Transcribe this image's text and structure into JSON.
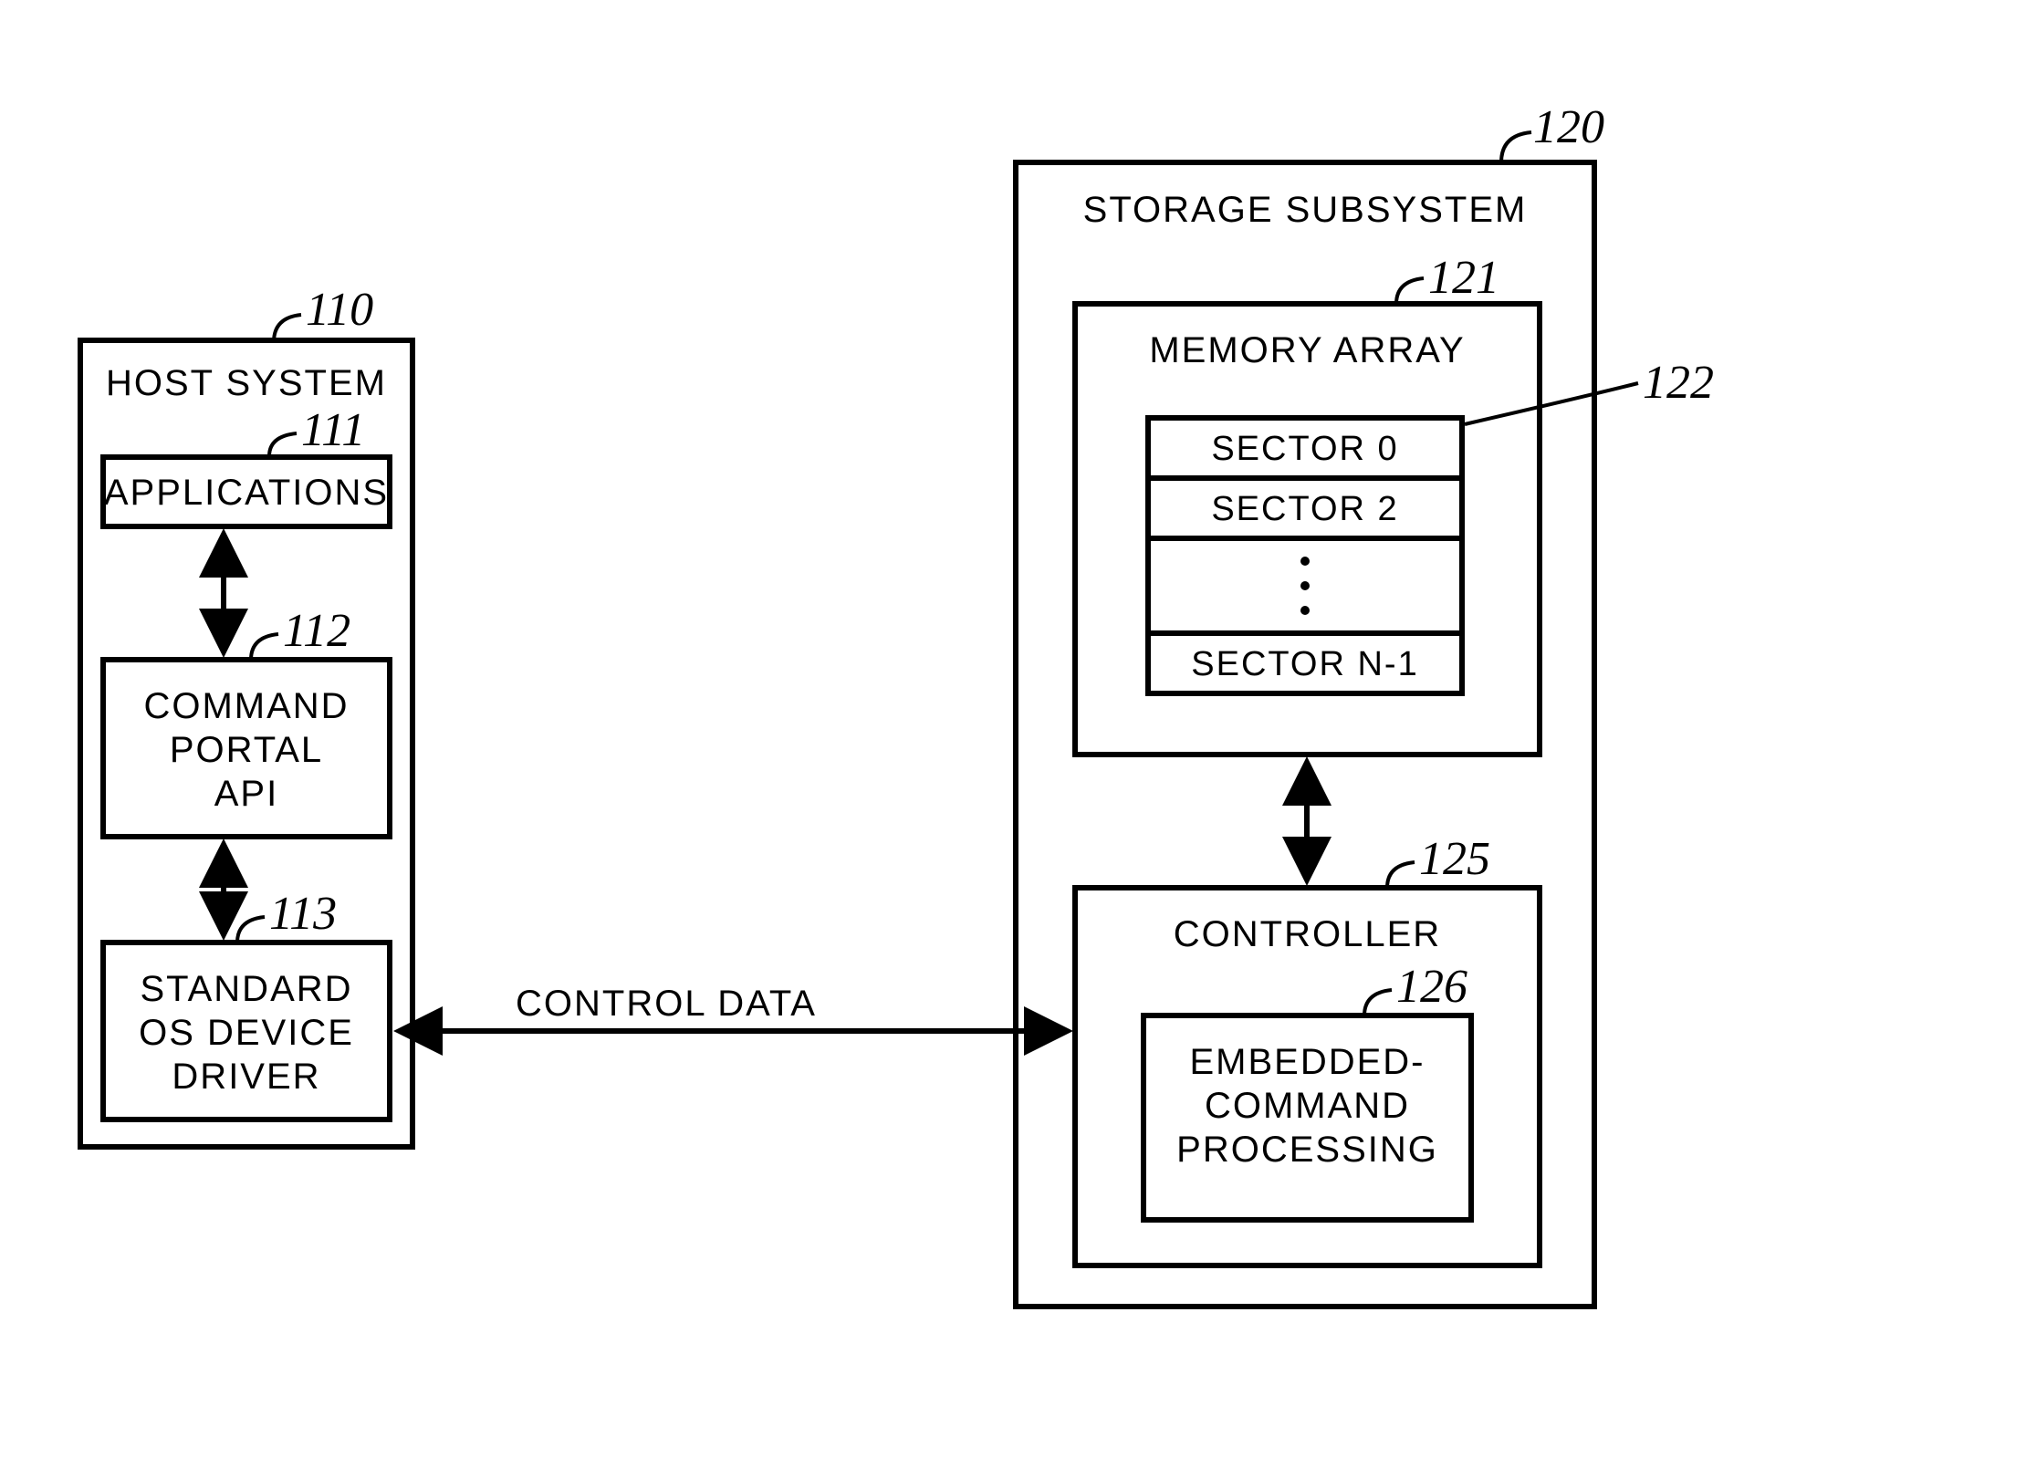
{
  "host": {
    "title": "HOST SYSTEM",
    "ref": "110",
    "applications": {
      "label": "APPLICATIONS",
      "ref": "111"
    },
    "api": {
      "label": "COMMAND\nPORTAL\nAPI",
      "ref": "112"
    },
    "driver": {
      "label": "STANDARD\nOS DEVICE\nDRIVER",
      "ref": "113"
    }
  },
  "link": {
    "label": "CONTROL DATA"
  },
  "storage": {
    "title": "STORAGE SUBSYSTEM",
    "ref": "120",
    "memory": {
      "title": "MEMORY ARRAY",
      "ref": "121",
      "sector_ref": "122",
      "sectors": {
        "s0": "SECTOR 0",
        "s1": "SECTOR 2",
        "sN": "SECTOR N-1"
      }
    },
    "controller": {
      "title": "CONTROLLER",
      "ref": "125",
      "embedded": {
        "label": "EMBEDDED-\nCOMMAND\nPROCESSING",
        "ref": "126"
      }
    }
  }
}
